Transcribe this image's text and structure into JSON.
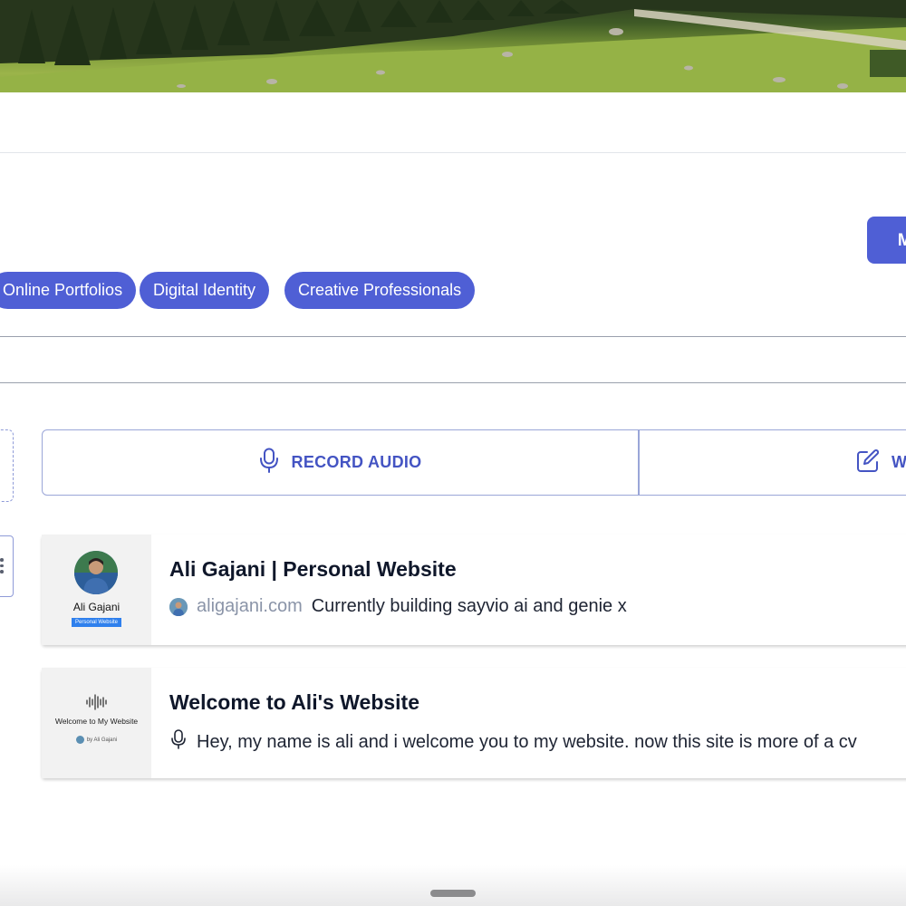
{
  "header": {
    "primary_button_label": "Ma"
  },
  "tags": [
    "Online Portfolios",
    "Digital Identity",
    "Creative Professionals"
  ],
  "actions": {
    "record_audio_label": "RECORD AUDIO",
    "write_label": "W"
  },
  "posts": [
    {
      "title": "Ali Gajani | Personal Website",
      "domain": "aligajani.com",
      "description": "Currently building sayvio ai and genie x",
      "thumb_name": "Ali Gajani",
      "thumb_badge": "Personal Website"
    },
    {
      "title": "Welcome to Ali's Website",
      "description": "Hey, my name is ali and i welcome you to my website. now this site is more of a cv",
      "thumb_title": "Welcome to My Website",
      "thumb_by": "by Ali Gajani"
    }
  ],
  "colors": {
    "accent": "#4f5fd5",
    "accent_text": "#4454c3"
  }
}
